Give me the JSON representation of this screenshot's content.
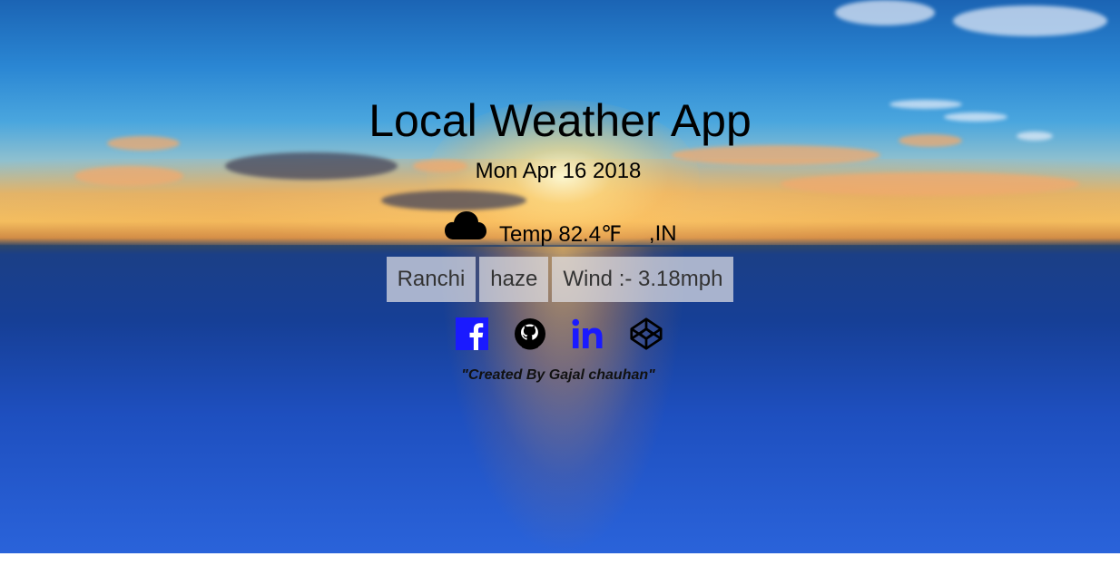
{
  "app": {
    "title": "Local Weather App",
    "date": "Mon Apr 16 2018"
  },
  "weather": {
    "icon": "cloud-icon",
    "temp": "Temp 82.4℉",
    "country": ",IN",
    "city": "Ranchi",
    "condition": "haze",
    "wind": "Wind :- 3.18mph"
  },
  "social": [
    {
      "name": "facebook-icon",
      "color": "#1a1aff"
    },
    {
      "name": "github-icon",
      "color": "#000000"
    },
    {
      "name": "linkedin-icon",
      "color": "#1a1aff"
    },
    {
      "name": "codepen-icon",
      "color": "#000000"
    }
  ],
  "footer": {
    "credit": "\"Created By Gajal chauhan\""
  },
  "colors": {
    "pill_background": "#e1e1e6",
    "social_blue": "#1a1aff",
    "text": "#000000"
  }
}
